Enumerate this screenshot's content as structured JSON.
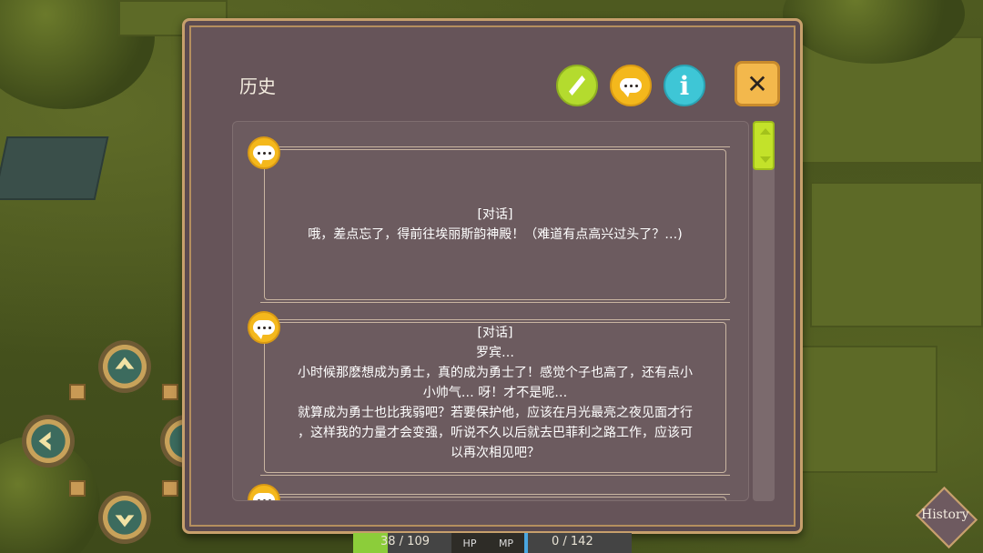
{
  "dialog": {
    "title": "历史",
    "close_symbol": "✕",
    "info_symbol": "i",
    "toolbar_icons": [
      "quest-quill-icon",
      "dialog-bubble-icon",
      "info-icon"
    ]
  },
  "history": [
    {
      "type_label": "[对话]",
      "lines": [
        "哦，差点忘了，得前往埃丽斯韵神殿！（难道有点高兴过头了？…)"
      ]
    },
    {
      "type_label": "[对话]",
      "lines": [
        "罗宾…",
        "小时候那麽想成为勇士，真的成为勇士了！感觉个子也高了，还有点小",
        "小帅气… 呀！才不是呢…",
        "就算成为勇士也比我弱吧？若要保护他，应该在月光最亮之夜见面才行",
        "，这样我的力量才会变强，听说不久以后就去巴菲利之路工作，应该可",
        "以再次相见吧？"
      ]
    }
  ],
  "hud": {
    "hp_current": "38",
    "hp_max": "109",
    "hp_text": "38 / 109",
    "hp_fraction": 0.35,
    "hp_label": "HP",
    "mp_label": "MP",
    "mp_text": "0 / 142",
    "mp_fraction": 0.03
  },
  "history_button": "History",
  "colors": {
    "panel": "#665459",
    "border_gold": "#c7a06c",
    "quest_green": "#b4db2e",
    "dialog_yellow": "#f4b81c",
    "info_cyan": "#3ec6d6",
    "close_orange": "#f3b84c"
  }
}
